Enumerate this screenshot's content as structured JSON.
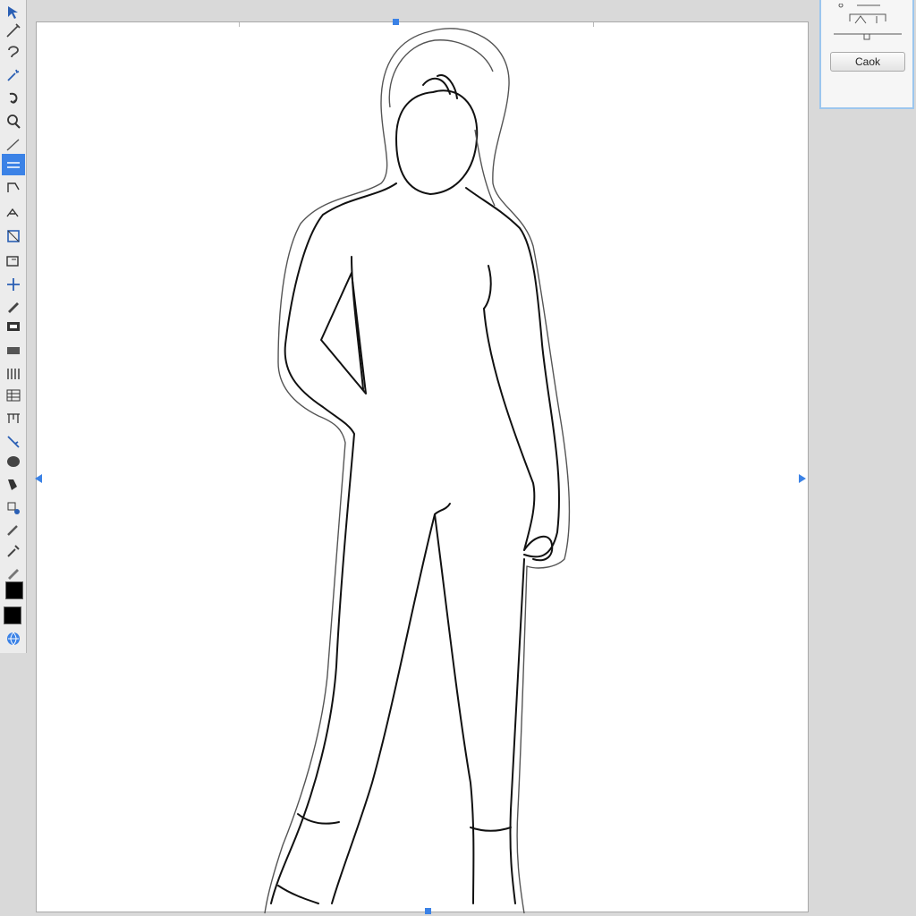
{
  "toolbar": {
    "tools": [
      {
        "icon": "select-icon"
      },
      {
        "icon": "pen-icon"
      },
      {
        "icon": "lasso-icon"
      },
      {
        "icon": "magic-wand-icon"
      },
      {
        "icon": "rotate-icon"
      },
      {
        "icon": "zoom-icon"
      },
      {
        "icon": "pencil-icon"
      },
      {
        "icon": "text-tool-icon",
        "active": true
      },
      {
        "icon": "path-icon"
      },
      {
        "icon": "node-icon"
      },
      {
        "icon": "transform-icon"
      },
      {
        "icon": "crop-icon"
      },
      {
        "icon": "move-icon"
      },
      {
        "icon": "pen-tool-icon"
      },
      {
        "icon": "layers-icon"
      },
      {
        "icon": "gradient-icon"
      },
      {
        "icon": "grid-icon"
      },
      {
        "icon": "table-icon"
      },
      {
        "icon": "measure-icon"
      },
      {
        "icon": "warp-icon"
      },
      {
        "icon": "blob-icon"
      },
      {
        "icon": "paint-bucket-icon"
      },
      {
        "icon": "shape-icon"
      },
      {
        "icon": "brush-icon"
      },
      {
        "icon": "eyedropper-icon"
      },
      {
        "icon": "eraser-icon"
      }
    ],
    "foreground_color": "#000000",
    "background_color": "#000000"
  },
  "accent_color": "#3b82e6",
  "panel": {
    "button_label": "Caok"
  }
}
